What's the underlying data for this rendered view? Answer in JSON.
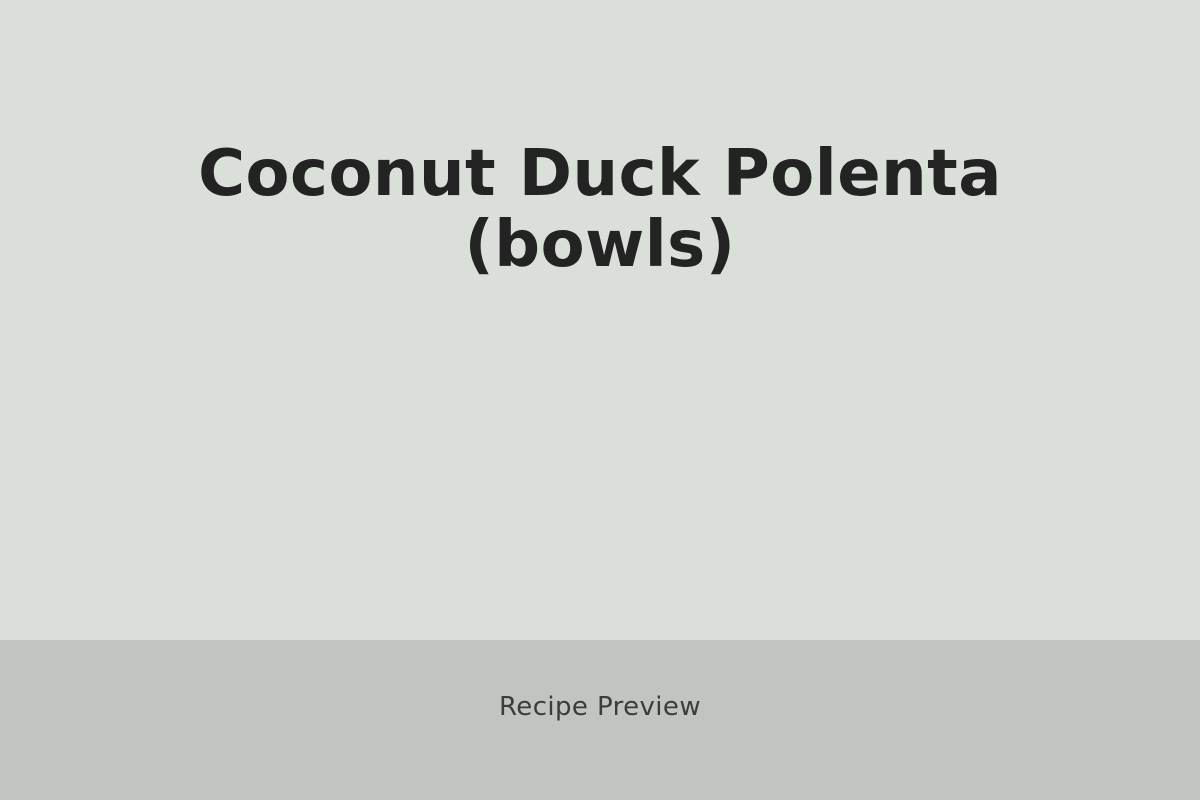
{
  "recipe": {
    "title_line_1": "Coconut Duck Polenta",
    "title_line_2": "(bowls)"
  },
  "footer": {
    "label": "Recipe Preview"
  },
  "colors": {
    "background": "#dae0d9",
    "footer_background": "#c0c6bf",
    "title_text": "#232323",
    "footer_text": "#3b3d3b"
  }
}
